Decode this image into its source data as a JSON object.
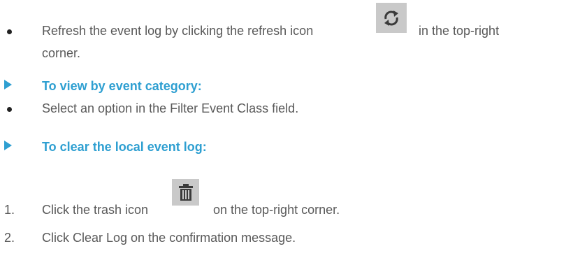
{
  "step_refresh": {
    "text_before": "Refresh the event log by clicking the refresh icon",
    "text_after": "in the top-right",
    "text_line2": "corner.",
    "icon": "refresh-icon"
  },
  "section_category": {
    "heading": "To view by event category:",
    "bullet_text": "Select an option in the Filter Event Class field."
  },
  "section_clear": {
    "heading": "To clear the local event log:",
    "steps": [
      {
        "number": "1.",
        "text_before": "Click the trash icon",
        "text_after": "on the top-right corner.",
        "icon": "trash-icon"
      },
      {
        "number": "2.",
        "text": "Click Clear Log on the confirmation message."
      }
    ]
  },
  "colors": {
    "text": "#595959",
    "heading": "#2e9fd1",
    "icon_background": "#c9c9c9",
    "icon_foreground": "#3a3a3a"
  }
}
